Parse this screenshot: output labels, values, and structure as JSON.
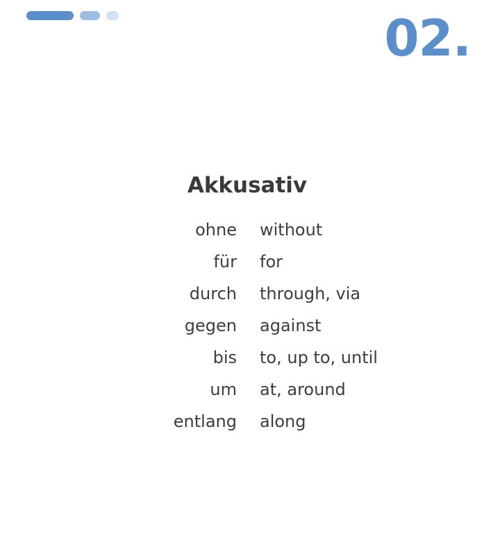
{
  "header": {
    "slide_number": "02.",
    "progress_segments": [
      {
        "color": "#5b8fcb"
      },
      {
        "color": "#9dbde2"
      },
      {
        "color": "#d1e0f2"
      }
    ]
  },
  "content": {
    "title": "Akkusativ",
    "rows": [
      {
        "term": "ohne",
        "translation": "without"
      },
      {
        "term": "für",
        "translation": "for"
      },
      {
        "term": "durch",
        "translation": "through, via"
      },
      {
        "term": "gegen",
        "translation": "against"
      },
      {
        "term": "bis",
        "translation": "to, up to, until"
      },
      {
        "term": "um",
        "translation": "at, around"
      },
      {
        "term": "entlang",
        "translation": "along"
      }
    ]
  },
  "colors": {
    "accent": "#5b8fcb",
    "text": "#3d3d3d",
    "background": "#ffffff"
  }
}
